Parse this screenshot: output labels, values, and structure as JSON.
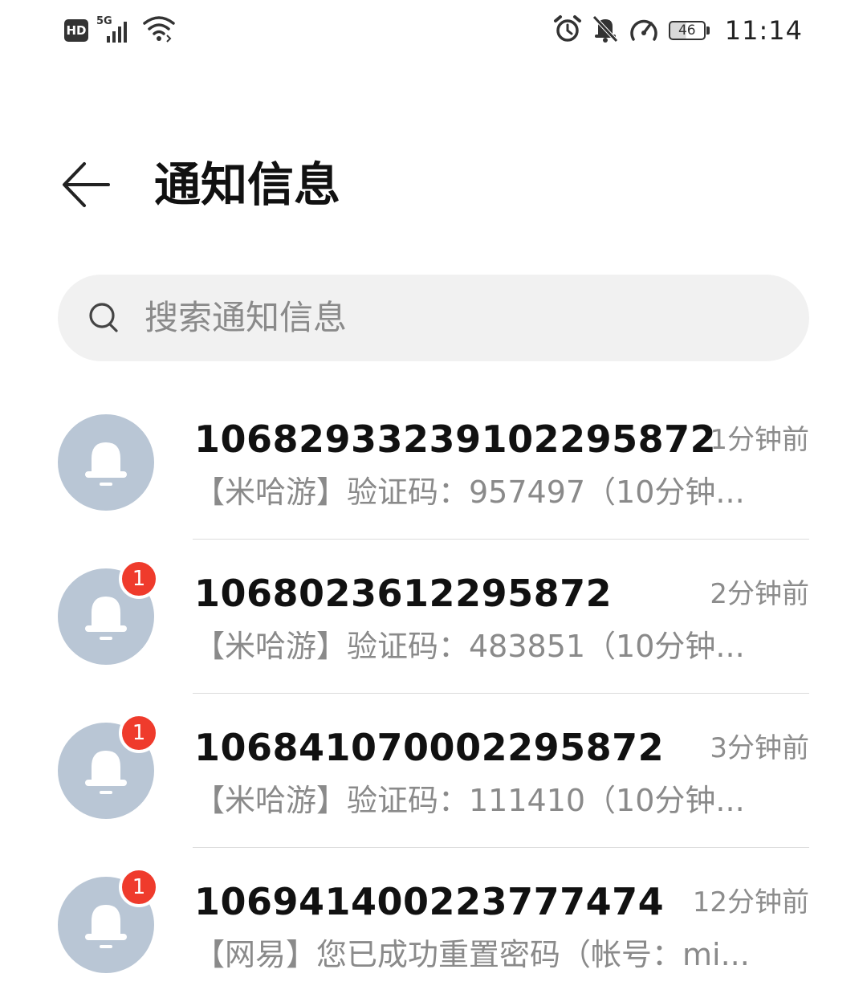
{
  "status_bar": {
    "hd": "HD",
    "network": "5G",
    "battery": "46",
    "battery_level_percent": 46,
    "time": "11:14",
    "icons": [
      "hd-icon",
      "signal-5g-icon",
      "wifi-icon",
      "alarm-icon",
      "bell-off-icon",
      "speedometer-icon",
      "battery-icon"
    ]
  },
  "header": {
    "title": "通知信息",
    "back_icon": "arrow-left-icon"
  },
  "search": {
    "placeholder": "搜索通知信息",
    "icon": "search-icon"
  },
  "messages": [
    {
      "sender": "1068293323910229​5872",
      "time": "1分钟前",
      "preview": "【米哈游】验证码：957497（10分钟...",
      "unread": ""
    },
    {
      "sender": "106802361229​5872",
      "time": "2分钟前",
      "preview": "【米哈游】验证码：483851（10分钟...",
      "unread": "1"
    },
    {
      "sender": "106841070002295872",
      "time": "3分钟前",
      "preview": "【米哈游】验证码：111410（10分钟...",
      "unread": "1"
    },
    {
      "sender": "10694140022​3777474",
      "time": "12分钟前",
      "preview": "【网易】您已成功重置密码（帐号：mi...",
      "unread": "1"
    }
  ],
  "colors": {
    "avatar_bg": "#b9c6d5",
    "badge_red": "#ef3b2c",
    "search_bg": "#f1f1f1"
  }
}
